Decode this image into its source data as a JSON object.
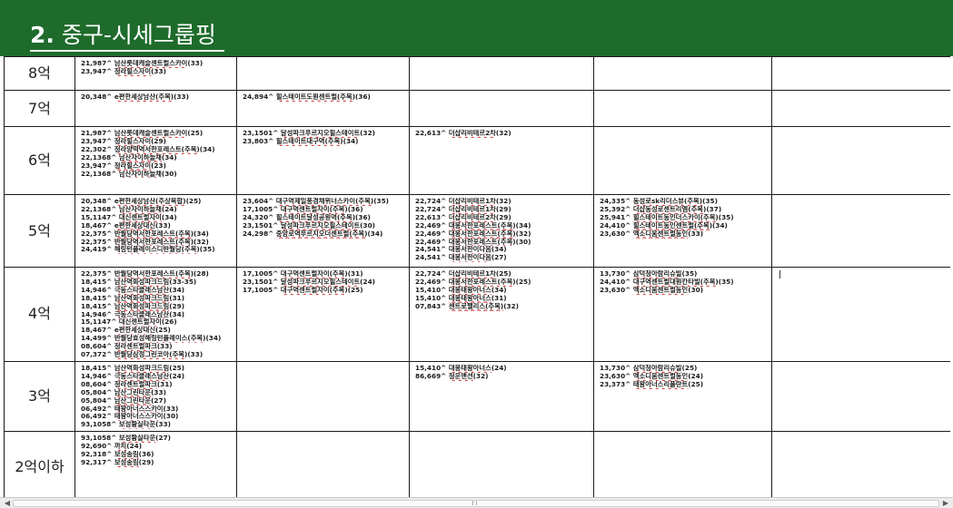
{
  "document": {
    "title_number": "2.",
    "title_text": " 중구-시세그룹핑"
  },
  "rows": [
    {
      "label": "8억",
      "cells": [
        [
          "21,987^ 남산롯데캐슬센트럴스카이(33)",
          "23,947^ 청라힐스자이(33)"
        ],
        [],
        [],
        [],
        []
      ]
    },
    {
      "label": "7억",
      "cells": [
        [
          "20,348^ e편한세상남산(주복)(33)"
        ],
        [
          "24,894^ 힐스테이트도원센트럴(주복)(36)"
        ],
        [],
        [],
        []
      ]
    },
    {
      "label": "6억",
      "cells": [
        [
          "21,987^ 남산롯데캐슬센트럴스카이(25)",
          "23,947^ 청라힐스자이(29)",
          "22,302^ 청라양떡역서한포레스트(주복)(34)",
          "22,1368^ 남산자이하늘채(34)",
          "23,947^ 청라힐스자이(23)",
          "22,1368^ 남산자이하늘채(30)"
        ],
        [
          "23,1501^ 달성파크푸르지오힐스테이트(32)",
          "23,803^ 힐스테이트대구역(주복)(34)"
        ],
        [
          "22,613^ 더샵리비테르2차(32)"
        ],
        [],
        []
      ]
    },
    {
      "label": "5억",
      "cells": [
        [
          "20,348^ e편한세상남산(주상복합)(25)",
          "22,1368^ 남산자이하늘채(24)",
          "15,1147^ 대신센트럴자이(34)",
          "18,467^ e편한세상대신(33)",
          "22,375^ 반월당역서한포레스트(주복)(34)",
          "22,375^ 반월당역서한포레스트(주복)(32)",
          "24,419^ 해링턴플레이스디반월당(주복)(35)"
        ],
        [
          "23,604^ 대구역제일풍경채위너스카이(주복)(35)",
          "17,1005^ 대구역센트럴자이(주복)(36)",
          "24,320^ 힐스테이트달성공원역(주복)(36)",
          "23,1501^ 달성파크푸르지오힐스테이트(30)",
          "24,298^ 중앙로역푸르지오더센트럴(주복)(34)"
        ],
        [
          "22,724^ 더샵리비테르1차(32)",
          "22,724^ 더샵리비테르1차(29)",
          "22,613^ 더샵리비테르2차(29)",
          "22,469^ 대봉서한포레스트(주복)(34)",
          "22,469^ 대봉서한포레스트(주복)(32)",
          "22,469^ 대봉서한포레스트(주복)(30)",
          "24,541^ 대봉서한이다음(34)",
          "24,541^ 대봉서한이다음(27)"
        ],
        [
          "24,335^ 동성로sk리더스뷰(주복)(35)",
          "25,392^ 더샵동성로센트리엠(주복)(37)",
          "25,941^ 힐스테이트동인더스카이(주복)(35)",
          "24,410^ 힐스테이트동인센트럴(주복)(34)",
          "23,630^ 엑소디움센트럴동인(33)"
        ],
        []
      ]
    },
    {
      "label": "4억",
      "cells": [
        [
          "22,375^ 반월당역서한포레스트(주복)(28)",
          "18,415^ 남산역화성파크드림(33-35)",
          "14,946^ 극동스타클래스남산(34)",
          "18,415^ 남산역화성파크드림(31)",
          "18,415^ 남산역화성파크드림(29)",
          "14,946^ 극동스타클래스남산(34)",
          "15,1147^ 대신센트럴자이(26)",
          "18,467^ e편한세상대신(25)",
          "14,499^ 반월당효성해링턴플레이스(주복)(34)",
          "08,604^ 청라센트럴파크(33)",
          "07,372^ 반월당삼정그린코아(주복)(33)"
        ],
        [
          "17,1005^ 대구역센트럴자이(주복)(31)",
          "23,1501^ 달성파크푸르지오힐스테이트(24)",
          "17,1005^ 대구역센트럴자이(주복)(25)"
        ],
        [
          "22,724^ 더샵리비테르1차(25)",
          "22,469^ 대봉서한포레스트(주복)(25)",
          "15,410^ 대봉태왕아너스(34)",
          "15,410^ 대봉태왕아너스(31)",
          "07,843^ 센트로팰리스(주복)(32)"
        ],
        [
          "13,730^ 삼덕청아람리슈빌(35)",
          "24,410^ 대구역센트럴대원칸타빌(주복)(35)",
          "23,630^ 엑소디움센트럴동인(30)"
        ],
        []
      ]
    },
    {
      "label": "3억",
      "cells": [
        [
          "18,415^ 남산역화성파크드림(25)",
          "14,946^ 극동스타클래스남산(24)",
          "08,604^ 청라센트럴파크(31)",
          "05,804^ 남산그린타운(33)",
          "05,804^ 남산그린타운(27)",
          "06,492^ 태왕아너스스카이(33)",
          "06,492^ 태왕아너스스카이(30)",
          "93,1058^ 보성황실타운(33)"
        ],
        [],
        [
          "15,410^ 대봉태왕아너스(24)",
          "86,669^ 청운맨션(32)"
        ],
        [
          "13,730^ 삼덕청아람리슈빌(25)",
          "23,630^ 엑소디움센트럴동인(24)",
          "23,373^ 태왕아너스리플란트(25)"
        ],
        []
      ]
    },
    {
      "label": "2억이하",
      "cells": [
        [
          "93,1058^ 보성황실타운(27)",
          "92,690^ 까치(24)",
          "92,318^ 보성송림(36)",
          "92,317^ 보성송림(29)"
        ],
        [],
        [],
        [],
        []
      ]
    }
  ],
  "colors": {
    "banner": "#1e6b2c",
    "spellcheck_underline": "#d23030"
  },
  "scrollbar": {
    "left_icon": "scroll-left-arrow-icon",
    "right_icon": "scroll-right-arrow-icon"
  }
}
